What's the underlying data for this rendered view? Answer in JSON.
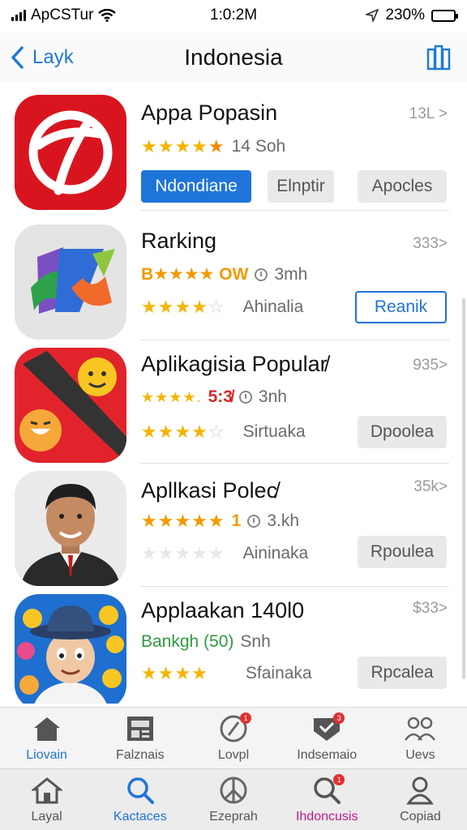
{
  "status_bar": {
    "carrier": "ApCSTur",
    "time": "1:0:2M",
    "battery": "230%",
    "battery_fill": 0.85
  },
  "nav": {
    "back_label": "Layk",
    "title": "Indonesia",
    "action_icon": "book-columns-icon"
  },
  "apps": [
    {
      "name": "Appa Popasin",
      "count": "13L >",
      "meta": "14 Soh",
      "buttons": [
        "Ndondiane",
        "Elnptir",
        "Apocles"
      ]
    },
    {
      "name": "Rarking",
      "count": "333>",
      "meta_tag": "B★★★★ OW",
      "meta": "3mh",
      "meta2": "Ahinalia",
      "button": "Reanik"
    },
    {
      "name": "Aplikagisia Popular̸",
      "count": "935>",
      "meta_tag": "5:3̸",
      "meta": "3nh",
      "meta2": "Sirtuaka",
      "button": "Dpoolea"
    },
    {
      "name": "Apllkasi Polec̸",
      "count": "35k>",
      "meta_tag": "1",
      "meta": "3.kh",
      "meta2": "Aininaka",
      "button": "Rpoulea"
    },
    {
      "name": "Applaakan 140l0",
      "count": "$33>",
      "meta_tag": "Bankgh (50)",
      "meta": "Snh",
      "meta2": "Sfainaka",
      "button": "Rpcalea"
    }
  ],
  "tabs_top": [
    {
      "label": "Liovain",
      "icon": "home-icon",
      "color": "#1f74d8"
    },
    {
      "label": "Falznais",
      "icon": "news-icon",
      "color": "#555555"
    },
    {
      "label": "Lovpl",
      "icon": "compass-icon",
      "color": "#555555",
      "badge": "1"
    },
    {
      "label": "Indsemaio",
      "icon": "heart-badge-icon",
      "color": "#555555",
      "badge": "3"
    },
    {
      "label": "Uevs",
      "icon": "people-icon",
      "color": "#555555"
    }
  ],
  "tabs_bottom": [
    {
      "label": "Layal",
      "icon": "home-icon",
      "color": "#555555"
    },
    {
      "label": "Kactaces",
      "icon": "search-icon",
      "color": "#1f74d8"
    },
    {
      "label": "Ezeprah",
      "icon": "peace-icon",
      "color": "#555555"
    },
    {
      "label": "Ihdoncusis",
      "icon": "search-badge-icon",
      "color": "#c0198a",
      "badge": "1"
    },
    {
      "label": "Copiad",
      "icon": "person-icon",
      "color": "#555555"
    }
  ]
}
